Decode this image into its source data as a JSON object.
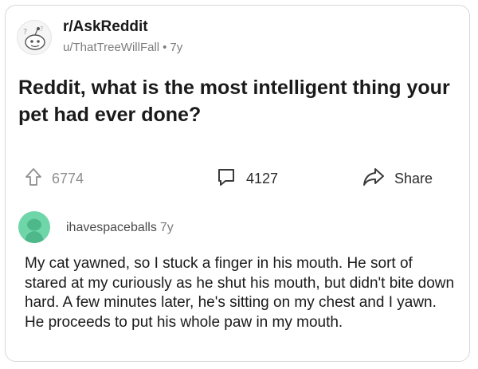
{
  "post": {
    "subreddit": "r/AskReddit",
    "author": "u/ThatTreeWillFall",
    "dot": "•",
    "age": "7y",
    "title": "Reddit, what is the most intelligent thing your pet had ever done?"
  },
  "actions": {
    "upvotes": "6774",
    "comments": "4127",
    "share": "Share"
  },
  "comment": {
    "username": "ihavespaceballs",
    "age": "7y",
    "body": "My cat yawned, so I stuck a finger in his mouth. He sort of stared at my curiously as he shut his mouth, but didn't bite down hard. A few minutes later, he's sitting on my chest and I yawn. He proceeds to put his whole paw in my mouth."
  },
  "icons": {
    "subreddit_avatar": "askreddit-snoo-icon",
    "upvote": "upvote-arrow-icon",
    "comments": "comment-bubble-icon",
    "share": "share-arrow-icon",
    "comment_avatar": "snoo-avatar-icon"
  },
  "colors": {
    "meta_text": "#7c7c7c",
    "comment_avatar": "#6ed6a9"
  }
}
